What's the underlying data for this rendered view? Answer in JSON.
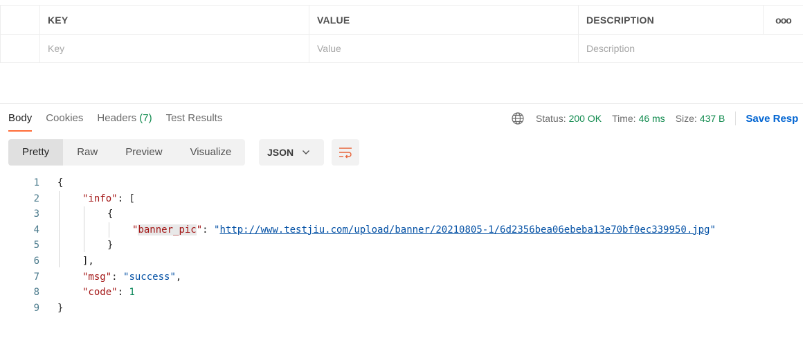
{
  "params_table": {
    "headers": {
      "key": "KEY",
      "value": "VALUE",
      "description": "DESCRIPTION",
      "more": "ooo"
    },
    "placeholders": {
      "key": "Key",
      "value": "Value",
      "description": "Description"
    }
  },
  "response_tabs": [
    {
      "label": "Body",
      "active": true
    },
    {
      "label": "Cookies"
    },
    {
      "label": "Headers",
      "count": "(7)"
    },
    {
      "label": "Test Results"
    }
  ],
  "status": {
    "status_label": "Status:",
    "status_value": "200 OK",
    "time_label": "Time:",
    "time_value": "46 ms",
    "size_label": "Size:",
    "size_value": "437 B",
    "save_label": "Save Resp"
  },
  "view_modes": [
    "Pretty",
    "Raw",
    "Preview",
    "Visualize"
  ],
  "format": "JSON",
  "code": {
    "line_numbers": [
      "1",
      "2",
      "3",
      "4",
      "5",
      "6",
      "7",
      "8",
      "9"
    ],
    "open_brace": "{",
    "info_key": "\"info\"",
    "colon": ": ",
    "open_bracket": "[",
    "inner_open": "{",
    "banner_key": "\"banner_pic\"",
    "quote": "\"",
    "url": "http://www.testjiu.com/upload/banner/20210805-1/6d2356bea06ebeba13e70bf0ec339950.jpg",
    "inner_close": "}",
    "close_bracket": "],",
    "msg_key": "\"msg\"",
    "msg_value": "\"success\"",
    "comma": ",",
    "code_key": "\"code\"",
    "code_value": "1",
    "close_brace": "}"
  },
  "colors": {
    "accent": "#ff6c37",
    "success": "#0f8a4d",
    "link": "#0265d2"
  }
}
